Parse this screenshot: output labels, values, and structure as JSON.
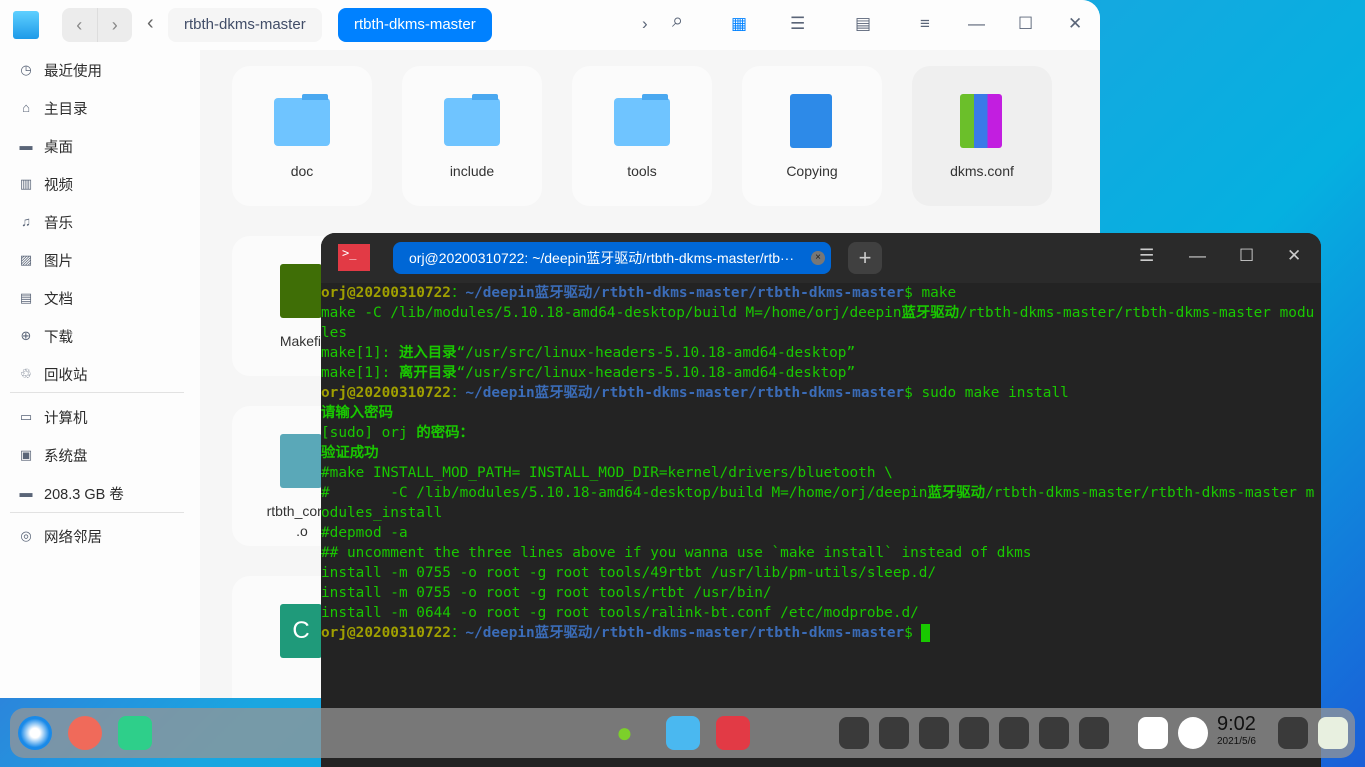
{
  "file_manager": {
    "nav": {
      "back": "‹",
      "forward": "›",
      "crumb_back": "‹"
    },
    "breadcrumbs": [
      "rtbth-dkms-master",
      "rtbth-dkms-master"
    ],
    "toolbar": {
      "next": "›",
      "search": "⌕",
      "icon_view": "▦",
      "list_view": "☰",
      "detail_view": "▤",
      "menu": "≡",
      "minimize": "—",
      "maximize": "☐",
      "close": "✕"
    },
    "sidebar": [
      {
        "label": "最近使用",
        "icon": "◷"
      },
      {
        "label": "主目录",
        "icon": "⌂"
      },
      {
        "label": "桌面",
        "icon": "▬"
      },
      {
        "label": "视频",
        "icon": "▥"
      },
      {
        "label": "音乐",
        "icon": "♫"
      },
      {
        "label": "图片",
        "icon": "▨"
      },
      {
        "label": "文档",
        "icon": "▤"
      },
      {
        "label": "下载",
        "icon": "⊕"
      },
      {
        "label": "回收站",
        "icon": "♲"
      },
      {
        "label": "计算机",
        "icon": "▭"
      },
      {
        "label": "系统盘",
        "icon": "▣"
      },
      {
        "label": "208.3 GB 卷",
        "icon": "▬"
      },
      {
        "label": "网络邻居",
        "icon": "◎"
      }
    ],
    "files": [
      {
        "name": "doc"
      },
      {
        "name": "include"
      },
      {
        "name": "tools"
      },
      {
        "name": "Copying"
      },
      {
        "name": "dkms.conf"
      },
      {
        "name": "Makefil"
      },
      {
        "name": "rtbth_core_"
      },
      {
        "name": ".o"
      },
      {
        "name": "C"
      }
    ]
  },
  "terminal": {
    "tab_title": "orj@20200310722: ~/deepin蓝牙驱动/rtbth-dkms-master/rtb···",
    "tab_close": "×",
    "add_tab": "+",
    "icon_text": ">_",
    "controls": {
      "menu": "☰",
      "minimize": "—",
      "maximize": "☐",
      "close": "✕"
    },
    "lines": [
      [
        [
          "u",
          "orj@20200310722"
        ],
        [
          "",
          "："
        ],
        [
          "p",
          "~/deepin蓝牙驱动/rtbth-dkms-master/rtbth-dkms-master"
        ],
        [
          "",
          "$ make"
        ]
      ],
      [
        [
          "",
          "make -C /lib/modules/5.10.18-amd64-desktop/build M=/home/orj/deepin"
        ],
        [
          "b",
          "蓝牙驱动"
        ],
        [
          "",
          "/rtbth-dkms-master/rtbth-dkms-master modules"
        ]
      ],
      [
        [
          "",
          "make[1]: "
        ],
        [
          "b",
          "进入目录"
        ],
        [
          "",
          "“/usr/src/linux-headers-5.10.18-amd64-desktop”"
        ]
      ],
      [
        [
          "",
          "make[1]: "
        ],
        [
          "b",
          "离开目录"
        ],
        [
          "",
          "“/usr/src/linux-headers-5.10.18-amd64-desktop”"
        ]
      ],
      [
        [
          "u",
          "orj@20200310722"
        ],
        [
          "",
          "："
        ],
        [
          "p",
          "~/deepin蓝牙驱动/rtbth-dkms-master/rtbth-dkms-master"
        ],
        [
          "",
          "$ sudo make install"
        ]
      ],
      [
        [
          "b",
          "请输入密码"
        ]
      ],
      [
        [
          "",
          "[sudo] orj "
        ],
        [
          "b",
          "的密码："
        ]
      ],
      [
        [
          "b",
          "验证成功"
        ]
      ],
      [
        [
          "",
          "#make INSTALL_MOD_PATH= INSTALL_MOD_DIR=kernel/drivers/bluetooth \\"
        ]
      ],
      [
        [
          "",
          "#       -C /lib/modules/5.10.18-amd64-desktop/build M=/home/orj/deepin"
        ],
        [
          "b",
          "蓝牙驱动"
        ],
        [
          "",
          "/rtbth-dkms-master/rtbth-dkms-master modules_install"
        ]
      ],
      [
        [
          "",
          "#depmod -a"
        ]
      ],
      [
        [
          "",
          "## uncomment the three lines above if you wanna use `make install` instead of dkms"
        ]
      ],
      [
        [
          "",
          "install -m 0755 -o root -g root tools/49rtbt /usr/lib/pm-utils/sleep.d/"
        ]
      ],
      [
        [
          "",
          "install -m 0755 -o root -g root tools/rtbt /usr/bin/"
        ]
      ],
      [
        [
          "",
          "install -m 0644 -o root -g root tools/ralink-bt.conf /etc/modprobe.d/"
        ]
      ],
      [
        [
          "u",
          "orj@20200310722"
        ],
        [
          "",
          "："
        ],
        [
          "p",
          "~/deepin蓝牙驱动/rtbth-dkms-master/rtbth-dkms-master"
        ],
        [
          "",
          "$ "
        ]
      ]
    ]
  },
  "dock": {
    "time": "9:02",
    "date": "2021/5/6"
  }
}
